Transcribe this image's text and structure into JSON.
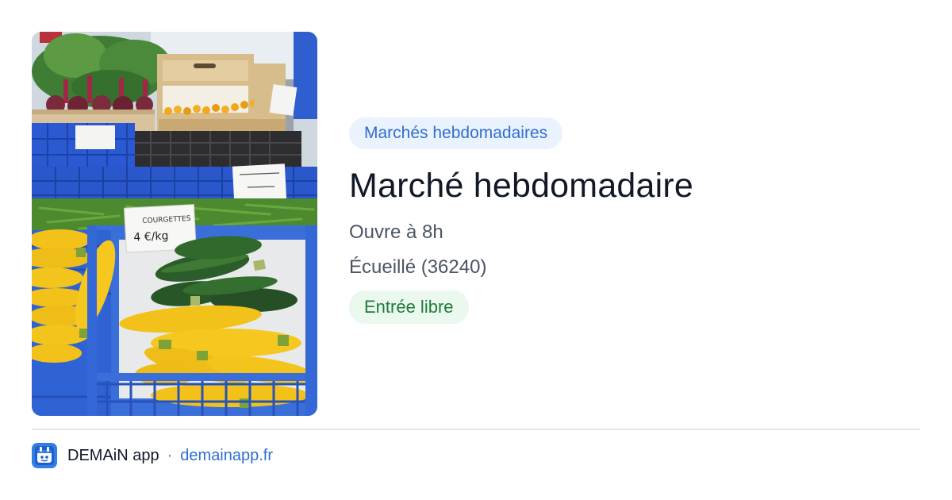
{
  "card": {
    "photo_description_icon": "market-vegetables-photo",
    "category_label": "Marchés hebdomadaires",
    "title": "Marché hebdomadaire",
    "opening": "Ouvre à 8h",
    "location": "Écueillé (36240)",
    "access_label": "Entrée libre"
  },
  "photo_signs": {
    "courgettes_label": "COURGETTES",
    "courgettes_price": "4 €/kg"
  },
  "footer": {
    "app_name": "DEMAiN app",
    "separator": "·",
    "domain": "demainapp.fr",
    "logo_icon": "demain-app-logo-icon"
  },
  "colors": {
    "category_chip_bg": "#eaf2fd",
    "category_chip_text": "#2f6fd1",
    "access_chip_bg": "#eaf8ee",
    "access_chip_text": "#1f7a3a",
    "link": "#2f6fd1"
  }
}
